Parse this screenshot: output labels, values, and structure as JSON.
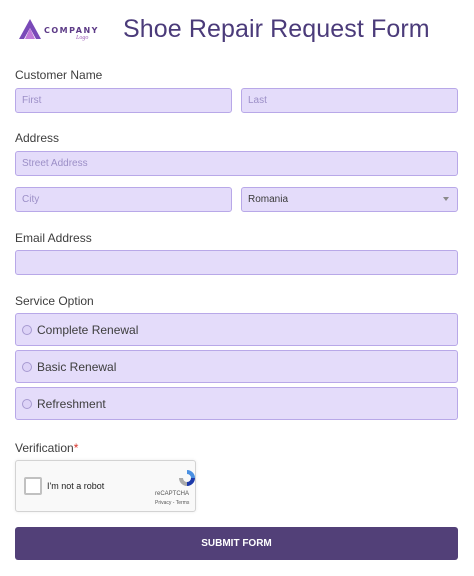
{
  "logo": {
    "name": "COMPANY",
    "sub": "Logo"
  },
  "title": "Shoe Repair Request Form",
  "customer_name": {
    "label": "Customer Name",
    "first_placeholder": "First",
    "last_placeholder": "Last"
  },
  "address": {
    "label": "Address",
    "street_placeholder": "Street Address",
    "city_placeholder": "City",
    "country_value": "Romania"
  },
  "email": {
    "label": "Email Address",
    "value": ""
  },
  "service": {
    "label": "Service Option",
    "options": [
      "Complete Renewal",
      "Basic Renewal",
      "Refreshment"
    ]
  },
  "verification": {
    "label": "Verification",
    "required_mark": "*",
    "captcha_text": "I'm not a robot",
    "captcha_brand": "reCAPTCHA",
    "captcha_links": "Privacy - Terms"
  },
  "submit_label": "SUBMIT FORM",
  "colors": {
    "accent": "#524078",
    "field_bg": "#e4dcfa",
    "field_border": "#b8a8e8",
    "title": "#4b3b7a"
  }
}
